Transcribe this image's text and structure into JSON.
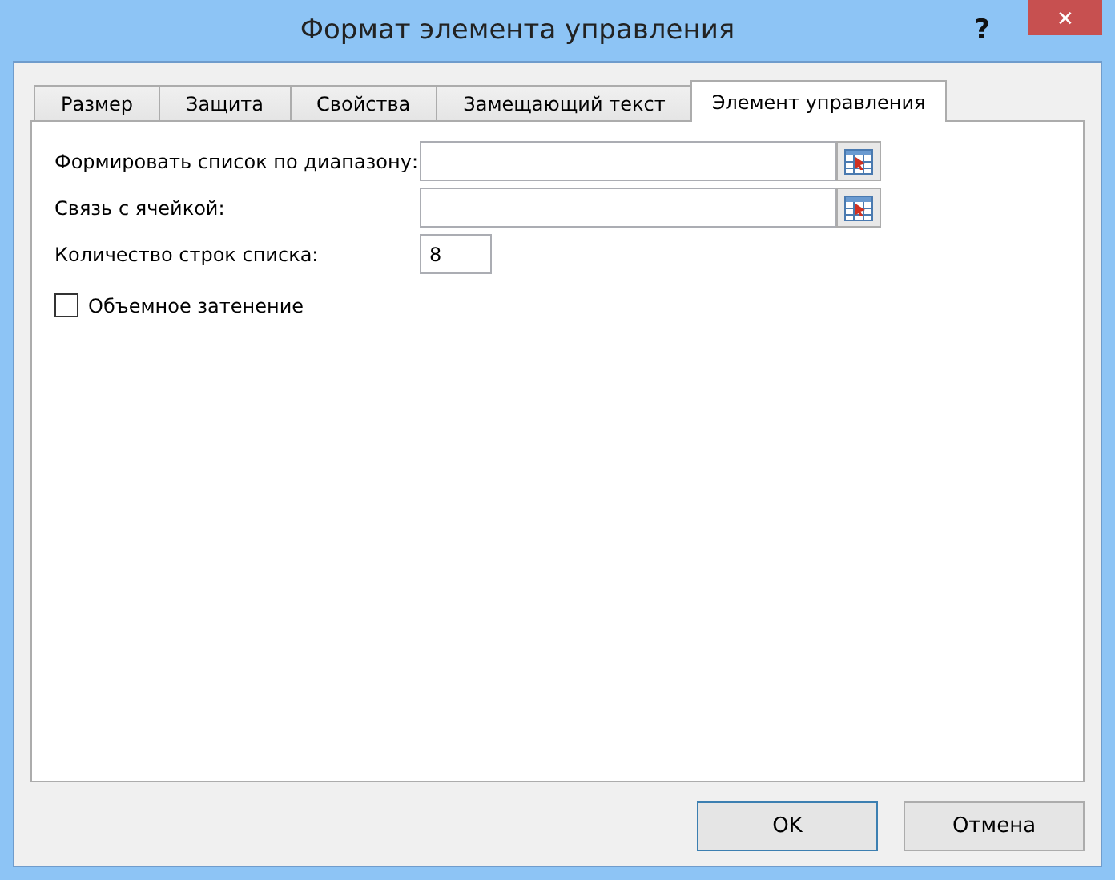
{
  "window": {
    "title": "Формат элемента управления",
    "help": "?",
    "close": "✕"
  },
  "tabs": [
    {
      "label": "Размер",
      "selected": false
    },
    {
      "label": "Защита",
      "selected": false
    },
    {
      "label": "Свойства",
      "selected": false
    },
    {
      "label": "Замещающий текст",
      "selected": false
    },
    {
      "label": "Элемент управления",
      "selected": true
    }
  ],
  "fields": [
    {
      "kind": "range",
      "label": "Формировать список по диапазону:"
    },
    {
      "kind": "range",
      "label": "Связь с ячейкой:"
    },
    {
      "kind": "number",
      "label": "Количество строк списка:",
      "value": "8"
    }
  ],
  "checkbox": {
    "label": "Объемное затенение",
    "checked": false
  },
  "buttons": [
    {
      "label": "OK",
      "default": true
    },
    {
      "label": "Отмена",
      "default": false
    }
  ]
}
